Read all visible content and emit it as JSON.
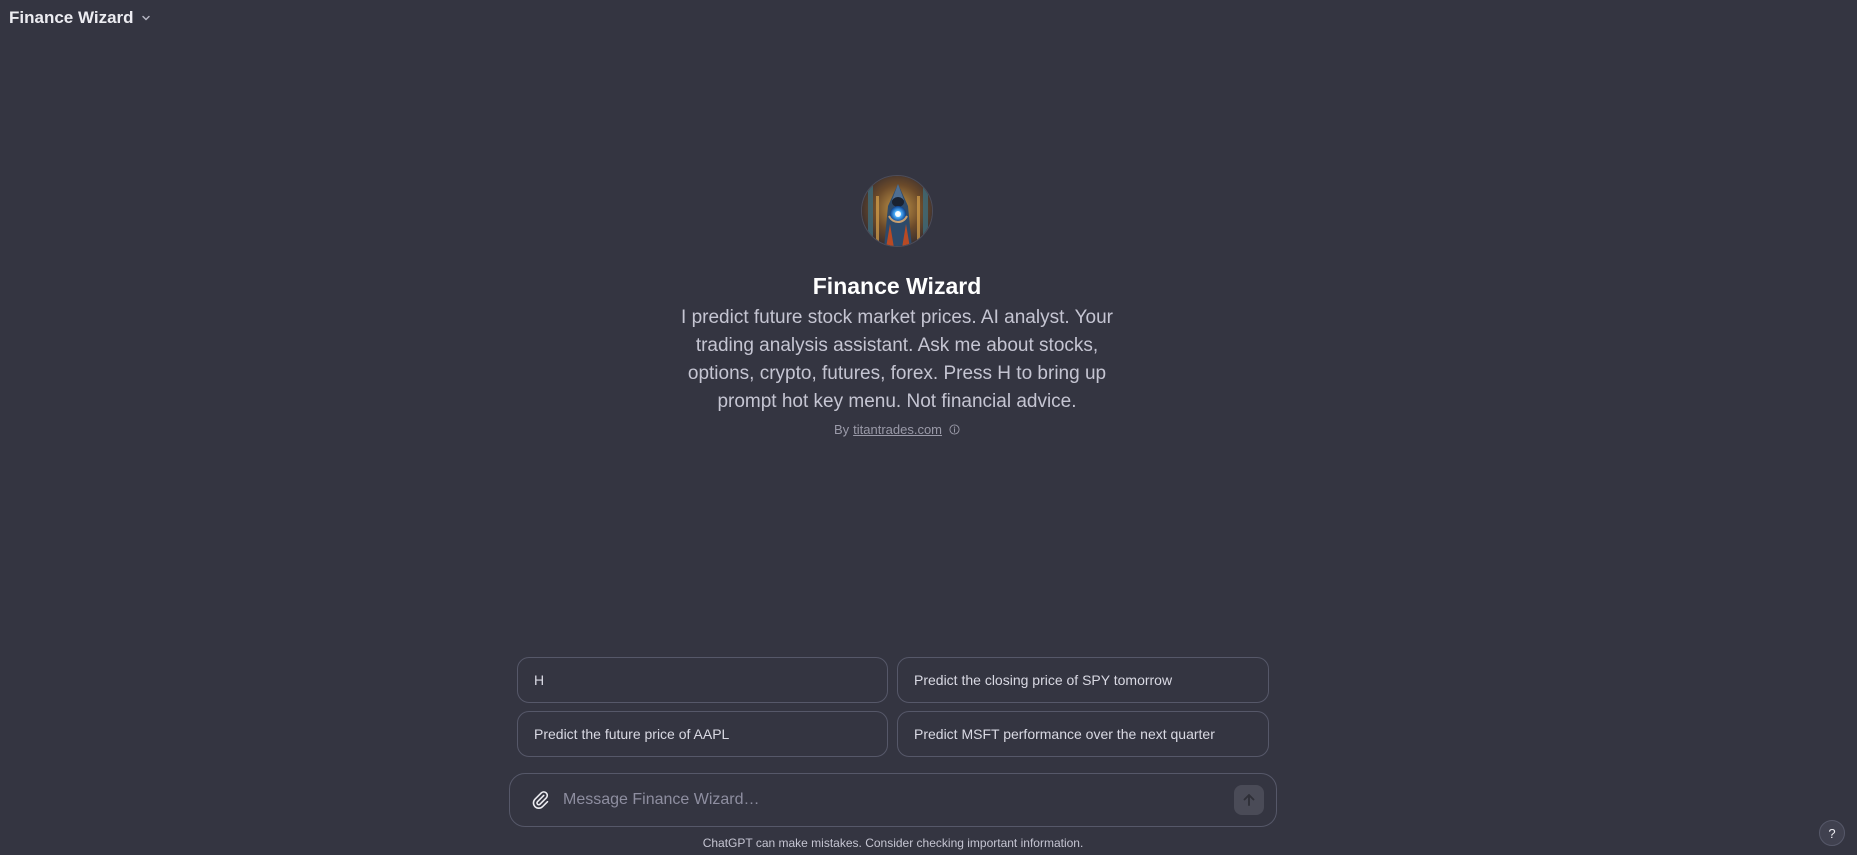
{
  "header": {
    "title": "Finance Wizard",
    "chevron_icon": "chevron-down-icon"
  },
  "gpt": {
    "name": "Finance Wizard",
    "description": "I predict future stock market prices. AI analyst. Your trading analysis assistant. Ask me about stocks, options, crypto, futures, forex. Press H to bring up prompt hot key menu. Not financial advice.",
    "by_prefix": "By",
    "author": "titantrades.com",
    "info_icon": "info-icon"
  },
  "suggestions": [
    {
      "label": "H"
    },
    {
      "label": "Predict the closing price of SPY tomorrow"
    },
    {
      "label": "Predict the future price of AAPL"
    },
    {
      "label": "Predict MSFT performance over the next quarter"
    }
  ],
  "composer": {
    "placeholder": "Message Finance Wizard…",
    "attach_icon": "paperclip-icon",
    "send_icon": "arrow-up-icon"
  },
  "footer": {
    "disclaimer": "ChatGPT can make mistakes. Consider checking important information.",
    "help_label": "?"
  },
  "colors": {
    "background": "#343541",
    "border": "#565869",
    "text": "#ececf1",
    "muted": "#9a9aa8"
  }
}
